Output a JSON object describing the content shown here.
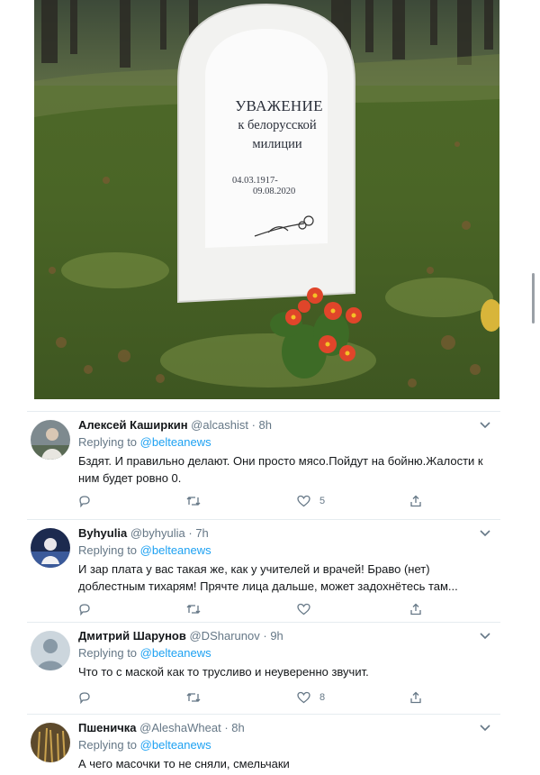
{
  "photo": {
    "headstone": {
      "title": "УВАЖЕНИЕ",
      "line1": "к белорусской",
      "line2": "милиции",
      "date_start": "04.03.1917-",
      "date_end": "09.08.2020"
    }
  },
  "tweets": [
    {
      "name": "Алексей Каширкин",
      "handle": "@alcashist",
      "time": "8h",
      "reply_prefix": "Replying to",
      "reply_to": "@belteanews",
      "text": "Бздят. И правильно делают. Они просто мясо.Пойдут на бойню.Жалости к ним будет ровно 0.",
      "likes": "5",
      "avatar_icon": "photo-avatar"
    },
    {
      "name": "Byhyulia",
      "handle": "@byhyulia",
      "time": "7h",
      "reply_prefix": "Replying to",
      "reply_to": "@belteanews",
      "text": "И зар плата у вас такая же, как у учителей и врачей! Браво (нет) доблестным тихарям! Прячте лица дальше, может задохнётесь там...",
      "likes": "",
      "avatar_icon": "photo-avatar"
    },
    {
      "name": "Дмитрий Шарунов",
      "handle": "@DSharunov",
      "time": "9h",
      "reply_prefix": "Replying to",
      "reply_to": "@belteanews",
      "text": "Что то с маской как то трусливо и неуверенно звучит.",
      "likes": "8",
      "avatar_icon": "default-avatar"
    },
    {
      "name": "Пшеничка",
      "handle": "@AleshaWheat",
      "time": "8h",
      "reply_prefix": "Replying to",
      "reply_to": "@belteanews",
      "text": "А чего масочки то не сняли, смельчаки",
      "likes": "",
      "avatar_icon": "photo-avatar"
    }
  ],
  "ui": {
    "dot": "·",
    "accent_color": "#1da1f2",
    "muted_color": "#657786"
  }
}
